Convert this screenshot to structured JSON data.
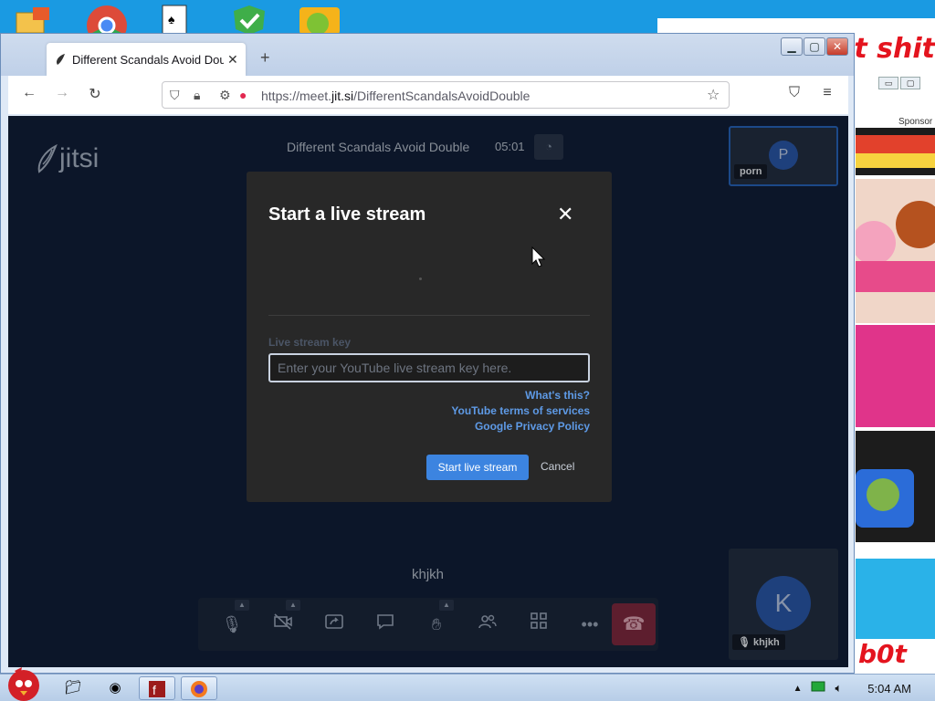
{
  "browser": {
    "tab_title": "Different Scandals Avoid Dou",
    "url_prefix": "https://meet.",
    "url_domain": "jit.si",
    "url_path": "/DifferentScandalsAvoidDouble"
  },
  "background_window": {
    "banner_text": "at shit",
    "sponsor_label": "Sponsor",
    "footer_text": "b0t"
  },
  "meeting": {
    "logo_text": "jitsi",
    "title": "Different Scandals Avoid Double",
    "timer": "05:01",
    "speaker_name": "khjkh",
    "participants": [
      {
        "initial": "P",
        "name": "porn"
      },
      {
        "initial": "K",
        "name": "khjkh"
      }
    ]
  },
  "dialog": {
    "title": "Start a live stream",
    "field_label": "Live stream key",
    "input_value": "",
    "input_placeholder": "Enter your YouTube live stream key here.",
    "link_whats_this": "What's this?",
    "link_terms": "YouTube terms of services",
    "link_privacy": "Google Privacy Policy",
    "start_label": "Start live stream",
    "cancel_label": "Cancel"
  },
  "taskbar": {
    "clock": "5:04 AM"
  },
  "colors": {
    "accent": "#3c84e0",
    "link": "#5e9ae6",
    "hangup": "#8a2538",
    "dialog_bg": "#282828",
    "meeting_bg": "#0f1930"
  },
  "icons": {
    "toolbar": [
      "microphone-icon",
      "camera-off-icon",
      "screen-share-icon",
      "chat-icon",
      "raise-hand-icon",
      "participants-icon",
      "tile-view-icon",
      "more-icon",
      "hangup-icon"
    ]
  }
}
